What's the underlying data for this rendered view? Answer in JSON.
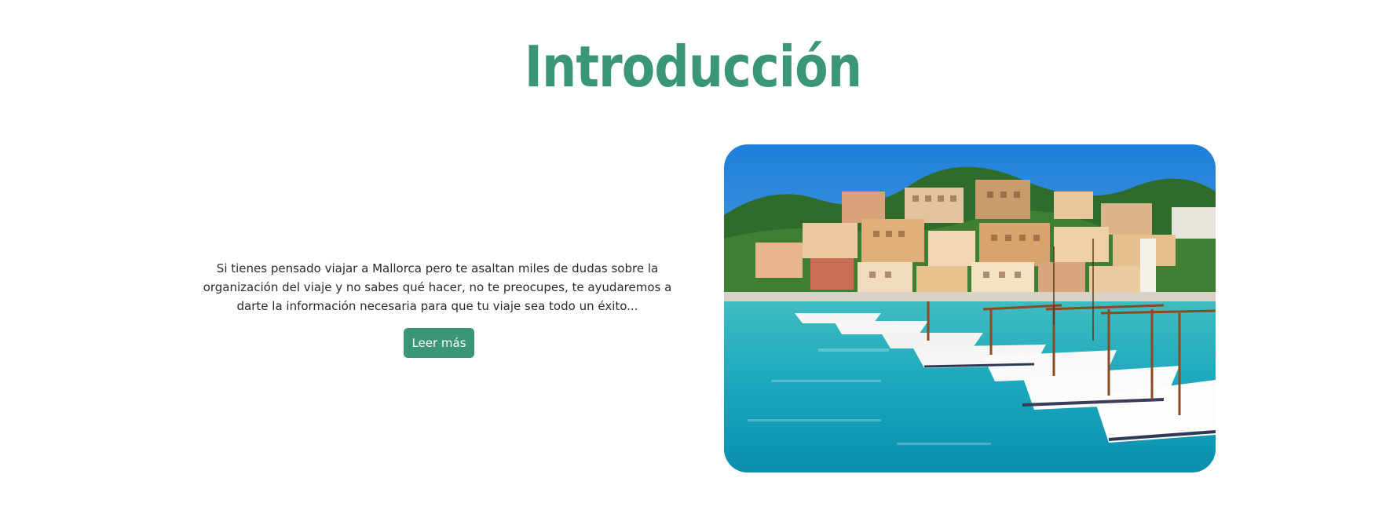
{
  "section": {
    "title": "Introducción",
    "description": "Si tienes pensado viajar a Mallorca pero te asaltan miles de dudas sobre la organización del viaje y no sabes qué hacer, no te preocupes, te ayudaremos a darte la información necesaria para que tu viaje sea todo un éxito...",
    "button_label": "Leer más"
  },
  "colors": {
    "accent": "#3a9579",
    "text": "#2b2b2b",
    "background": "#ffffff"
  },
  "image": {
    "subject": "harbor-photo"
  }
}
